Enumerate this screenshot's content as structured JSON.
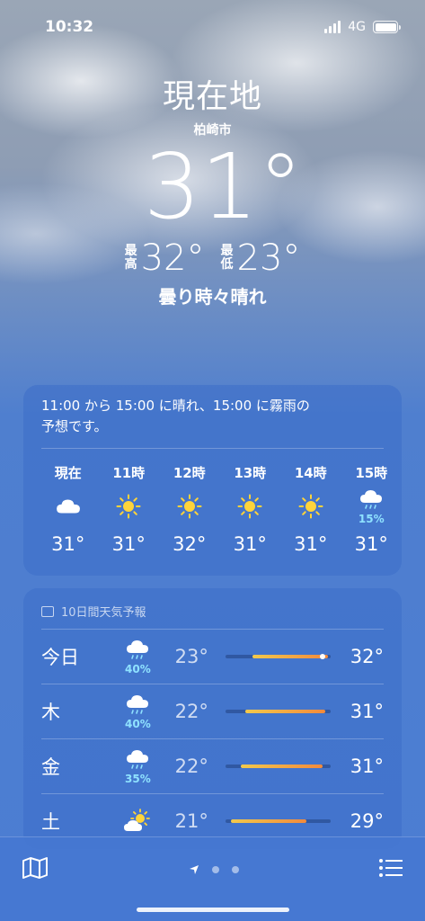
{
  "status": {
    "time": "10:32",
    "network": "4G"
  },
  "hero": {
    "location": "現在地",
    "sublocation": "柏崎市",
    "temperature": "31°",
    "high_label_1": "最",
    "high_label_2": "高",
    "high": "32°",
    "low_label_1": "最",
    "low_label_2": "低",
    "low": "23°",
    "condition": "曇り時々晴れ"
  },
  "hourly": {
    "summary_line1": "11:00 から 15:00 に晴れ、15:00 に霧雨の",
    "summary_line2": "予想です。",
    "items": [
      {
        "label": "現在",
        "icon": "cloud-icon",
        "temp": "31°",
        "pop": ""
      },
      {
        "label": "11時",
        "icon": "sun-icon",
        "temp": "31°",
        "pop": ""
      },
      {
        "label": "12時",
        "icon": "sun-icon",
        "temp": "32°",
        "pop": ""
      },
      {
        "label": "13時",
        "icon": "sun-icon",
        "temp": "31°",
        "pop": ""
      },
      {
        "label": "14時",
        "icon": "sun-icon",
        "temp": "31°",
        "pop": ""
      },
      {
        "label": "15時",
        "icon": "drizzle-icon",
        "temp": "31°",
        "pop": "15%"
      }
    ]
  },
  "daily": {
    "title": "10日間天気予報",
    "items": [
      {
        "day": "今日",
        "icon": "rain-icon",
        "pop": "40%",
        "low": "23°",
        "high": "32°",
        "range_start": 0.25,
        "range_end": 0.95,
        "now": 0.9
      },
      {
        "day": "木",
        "icon": "rain-icon",
        "pop": "40%",
        "low": "22°",
        "high": "31°",
        "range_start": 0.18,
        "range_end": 0.92
      },
      {
        "day": "金",
        "icon": "rain-icon",
        "pop": "35%",
        "low": "22°",
        "high": "31°",
        "range_start": 0.14,
        "range_end": 0.9
      },
      {
        "day": "土",
        "icon": "partly-cloudy-icon",
        "pop": "",
        "low": "21°",
        "high": "29°",
        "range_start": 0.05,
        "range_end": 0.75
      }
    ]
  },
  "colors": {
    "pop": "#8fe2ff",
    "sun": "#ffd43a",
    "bar_cool": "#f2c94c",
    "bar_warm": "#f28a3c"
  }
}
